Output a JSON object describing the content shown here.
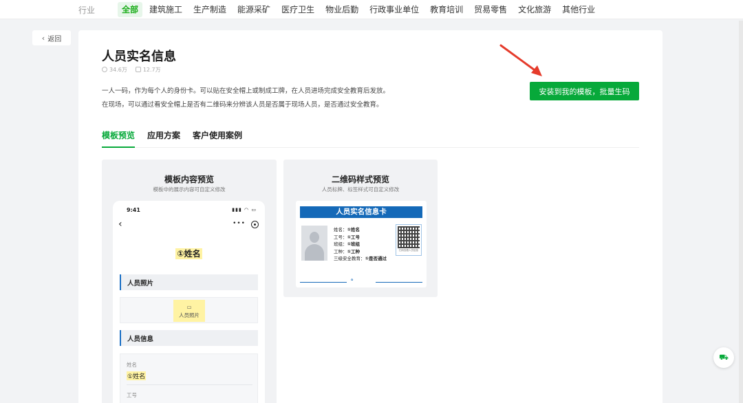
{
  "topbar": {
    "label": "行业",
    "categories": [
      "全部",
      "建筑施工",
      "生产制造",
      "能源采矿",
      "医疗卫生",
      "物业后勤",
      "行政事业单位",
      "教育培训",
      "贸易零售",
      "文化旅游",
      "其他行业"
    ]
  },
  "back_label": "返回",
  "template": {
    "title": "人员实名信息",
    "views": "34.6万",
    "uses": "12.7万",
    "desc_line1": "一人一码，作为每个人的身份卡。可以贴在安全帽上或制成工牌，在人员进场完成安全教育后发放。",
    "desc_line2": "在现场，可以通过看安全帽上是否有二维码来分辨该人员是否属于现场人员，是否通过安全教育。",
    "install_label": "安装到我的模板，批量生码"
  },
  "tabs": [
    "模板预览",
    "应用方案",
    "客户使用案例"
  ],
  "content_preview": {
    "title": "模板内容预览",
    "subtitle": "模板中的展示内容可自定义修改",
    "time": "9:41",
    "name_field": "①姓名",
    "section_photo": "人员照片",
    "photo_chip": "人员照片",
    "section_info": "人员信息",
    "fields": [
      {
        "label": "姓名",
        "value": "①姓名"
      },
      {
        "label": "工号",
        "value": ""
      }
    ]
  },
  "qr_preview": {
    "title": "二维码样式预览",
    "subtitle": "人员标牌、标签样式可自定义修改",
    "card_title": "人员实名信息卡",
    "rows": [
      {
        "k": "姓名：",
        "v": "①姓名"
      },
      {
        "k": "工号：",
        "v": "①工号"
      },
      {
        "k": "班组：",
        "v": "①班组"
      },
      {
        "k": "工种：",
        "v": "①工种"
      },
      {
        "k": "三级安全教育：",
        "v": "①是否通过"
      }
    ],
    "qr_caption": "扫码查看人员信息"
  },
  "colors": {
    "accent": "#07a93a",
    "card_blue": "#1469b8",
    "arrow": "#e53b2b"
  }
}
